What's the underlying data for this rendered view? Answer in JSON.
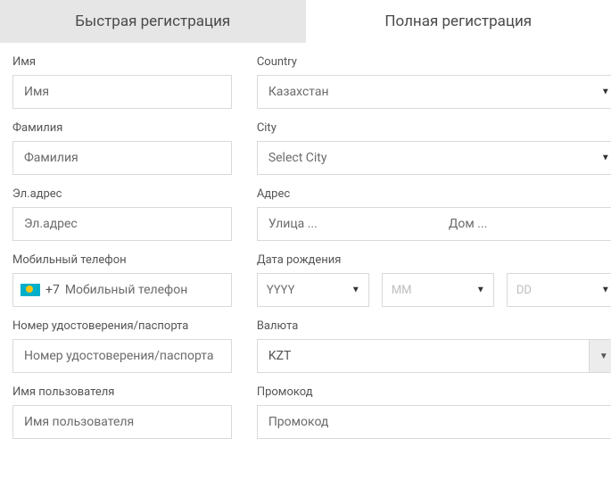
{
  "tabs": {
    "quick": "Быстрая регистрация",
    "full": "Полная регистрация"
  },
  "left": {
    "name_label": "Имя",
    "name_placeholder": "Имя",
    "surname_label": "Фамилия",
    "surname_placeholder": "Фамилия",
    "email_label": "Эл.адрес",
    "email_placeholder": "Эл.адрес",
    "phone_label": "Мобильный телефон",
    "phone_prefix": "+7",
    "phone_placeholder": "Мобильный телефон",
    "passport_label": "Номер удостоверения/паспорта",
    "passport_placeholder": "Номер удостоверения/паспорта",
    "username_label": "Имя пользователя",
    "username_placeholder": "Имя пользователя"
  },
  "right": {
    "country_label": "Country",
    "country_value": "Казахстан",
    "city_label": "City",
    "city_value": "Select City",
    "address_label": "Адрес",
    "street_placeholder": "Улица ...",
    "house_placeholder": "Дом ...",
    "dob_label": "Дата рождения",
    "dob_year": "YYYY",
    "dob_month": "MM",
    "dob_day": "DD",
    "currency_label": "Валюта",
    "currency_value": "KZT",
    "promo_label": "Промокод",
    "promo_placeholder": "Промокод"
  }
}
